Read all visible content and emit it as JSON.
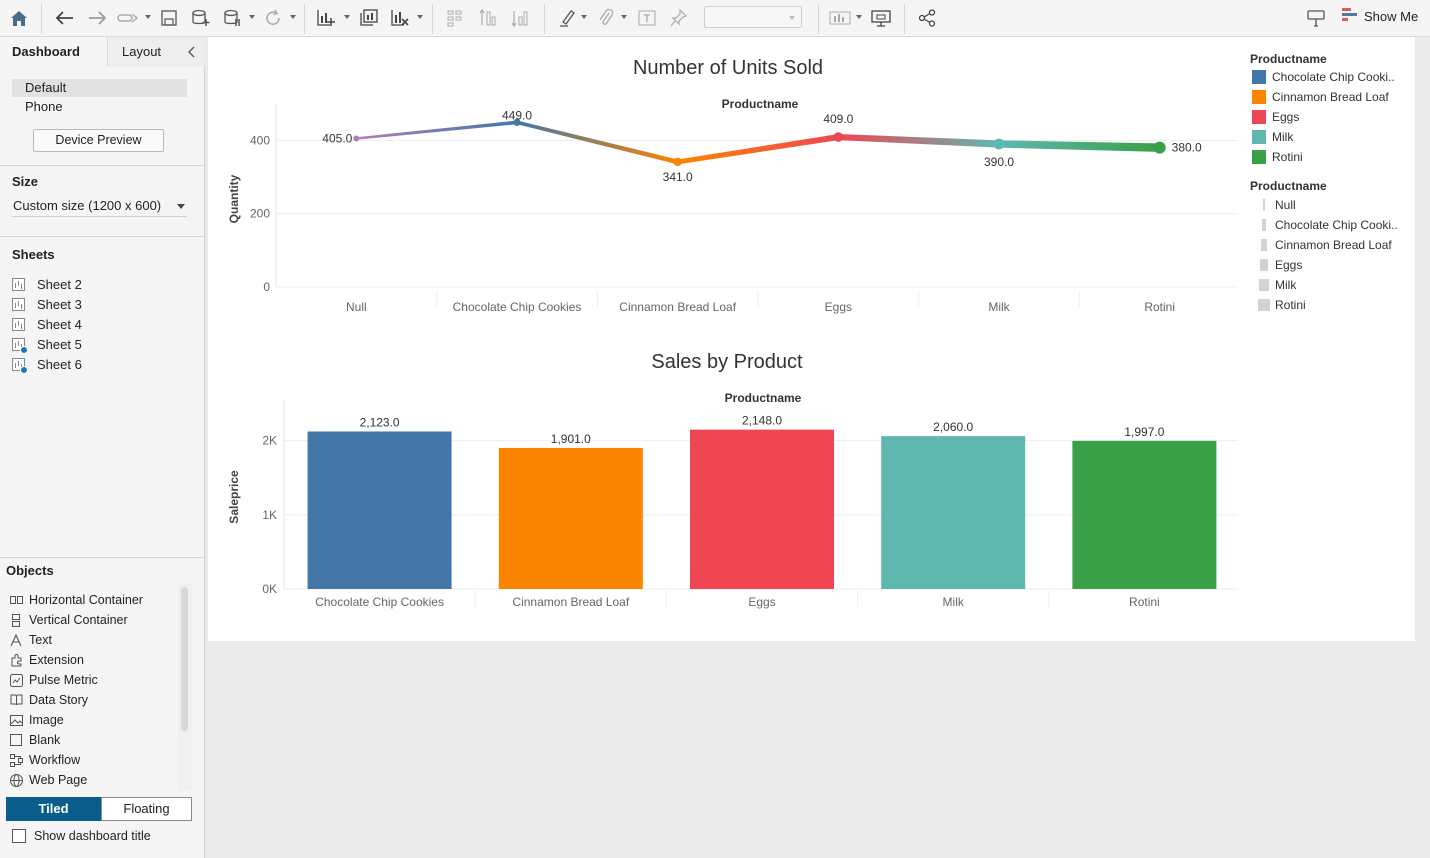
{
  "toolbar": {
    "show_me_label": "Show Me",
    "icons": [
      "home-icon",
      "undo-icon",
      "redo-icon",
      "replay-icon",
      "save-icon",
      "new-datasource-icon",
      "pause-updates-icon",
      "refresh-icon",
      "new-worksheet-icon",
      "duplicate-icon",
      "clear-icon",
      "swap-icon",
      "sort-asc-icon",
      "sort-desc-icon",
      "highlight-icon",
      "group-icon",
      "label-icon",
      "pin-icon",
      "fit-icon",
      "presentation-icon",
      "share-icon",
      "show-me-icon"
    ]
  },
  "left_panel": {
    "tabs": {
      "dashboard": "Dashboard",
      "layout": "Layout"
    },
    "devices": {
      "default": "Default",
      "phone": "Phone",
      "preview_button": "Device Preview"
    },
    "size": {
      "title": "Size",
      "value": "Custom size (1200 x 600)"
    },
    "sheets": {
      "title": "Sheets",
      "items": [
        "Sheet 2",
        "Sheet 3",
        "Sheet 4",
        "Sheet 5",
        "Sheet 6"
      ]
    },
    "objects": {
      "title": "Objects",
      "items": [
        {
          "label": "Horizontal Container",
          "icon": "horizontal-container-icon"
        },
        {
          "label": "Vertical Container",
          "icon": "vertical-container-icon"
        },
        {
          "label": "Text",
          "icon": "text-icon"
        },
        {
          "label": "Extension",
          "icon": "extension-icon"
        },
        {
          "label": "Pulse Metric",
          "icon": "pulse-metric-icon"
        },
        {
          "label": "Data Story",
          "icon": "data-story-icon"
        },
        {
          "label": "Image",
          "icon": "image-icon"
        },
        {
          "label": "Blank",
          "icon": "blank-icon"
        },
        {
          "label": "Workflow",
          "icon": "workflow-icon"
        },
        {
          "label": "Web Page",
          "icon": "web-page-icon"
        }
      ]
    },
    "layout_mode": {
      "tiled": "Tiled",
      "floating": "Floating"
    },
    "show_title_label": "Show dashboard title"
  },
  "legends": {
    "color": {
      "title": "Productname",
      "items": [
        {
          "label": "Chocolate Chip Cooki..",
          "color": "#4277a8"
        },
        {
          "label": "Cinnamon Bread Loaf",
          "color": "#fb8500"
        },
        {
          "label": "Eggs",
          "color": "#ef4654"
        },
        {
          "label": "Milk",
          "color": "#5eb8b0"
        },
        {
          "label": "Rotini",
          "color": "#3aa047"
        }
      ]
    },
    "size": {
      "title": "Productname",
      "items": [
        "Null",
        "Chocolate Chip Cooki..",
        "Cinnamon Bread Loaf",
        "Eggs",
        "Milk",
        "Rotini"
      ]
    }
  },
  "chart_data": [
    {
      "type": "line",
      "title": "Number of Units Sold",
      "header": "Productname",
      "xlabel": "",
      "ylabel": "Quantity",
      "categories": [
        "Null",
        "Chocolate Chip Cookies",
        "Cinnamon Bread Loaf",
        "Eggs",
        "Milk",
        "Rotini"
      ],
      "values": [
        405,
        449,
        341,
        409,
        390,
        380
      ],
      "data_labels": [
        "405.0",
        "449.0",
        "341.0",
        "409.0",
        "390.0",
        "380.0"
      ],
      "colors": [
        "#b07fb5",
        "#4277a8",
        "#fb8500",
        "#ef4654",
        "#5eb8b0",
        "#3aa047"
      ],
      "yticks": [
        "0",
        "200",
        "400"
      ],
      "ytick_values": [
        0,
        200,
        400
      ],
      "ylim": [
        0,
        480
      ],
      "grid": true
    },
    {
      "type": "bar",
      "title": "Sales by Product",
      "header": "Productname",
      "xlabel": "",
      "ylabel": "Saleprice",
      "categories": [
        "Chocolate Chip Cookies",
        "Cinnamon Bread Loaf",
        "Eggs",
        "Milk",
        "Rotini"
      ],
      "values": [
        2123,
        1901,
        2148,
        2060,
        1997
      ],
      "data_labels": [
        "2,123.0",
        "1,901.0",
        "2,148.0",
        "2,060.0",
        "1,997.0"
      ],
      "colors": [
        "#4277a8",
        "#fb8500",
        "#ef4654",
        "#5eb8b0",
        "#3aa047"
      ],
      "yticks": [
        "0K",
        "1K",
        "2K"
      ],
      "ytick_values": [
        0,
        1000,
        2000
      ],
      "ylim": [
        0,
        2480
      ],
      "grid": true
    }
  ]
}
